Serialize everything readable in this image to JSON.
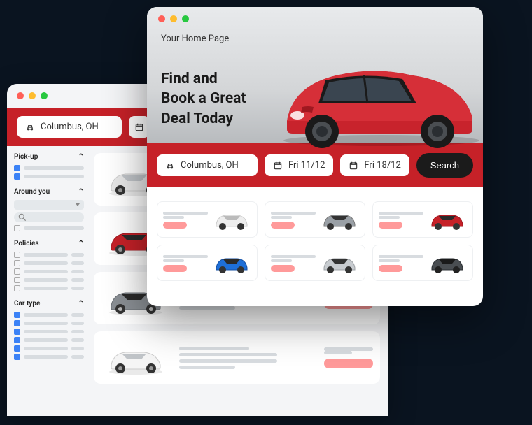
{
  "bg": {
    "location": "Columbus, OH",
    "filters": {
      "pickup": {
        "title": "Pick-up"
      },
      "around": {
        "title": "Around you"
      },
      "policies": {
        "title": "Policies"
      },
      "cartype": {
        "title": "Car type"
      }
    }
  },
  "fg": {
    "homeLabel": "Your Home Page",
    "heroLine1": "Find and",
    "heroLine2": "Book a Great",
    "heroLine3": "Deal Today",
    "location": "Columbus, OH",
    "date1": "Fri 11/12",
    "date2": "Fri 18/12",
    "searchLabel": "Search"
  }
}
